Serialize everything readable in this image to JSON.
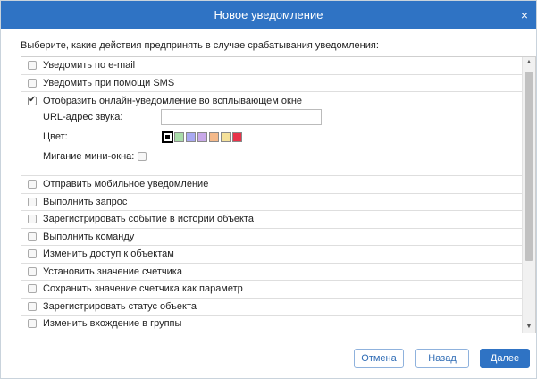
{
  "dialog": {
    "title": "Новое уведомление",
    "close_label": "×",
    "prompt": "Выберите, какие действия предпринять в случае срабатывания уведомления:"
  },
  "actions": [
    {
      "label": "Уведомить по e-mail",
      "checked": false
    },
    {
      "label": "Уведомить при помощи SMS",
      "checked": false
    },
    {
      "label": "Отобразить онлайн-уведомление во всплывающем окне",
      "checked": true
    },
    {
      "label": "Отправить мобильное уведомление",
      "checked": false
    },
    {
      "label": "Выполнить запрос",
      "checked": false
    },
    {
      "label": "Зарегистрировать событие в истории объекта",
      "checked": false
    },
    {
      "label": "Выполнить команду",
      "checked": false
    },
    {
      "label": "Изменить доступ к объектам",
      "checked": false
    },
    {
      "label": "Установить значение счетчика",
      "checked": false
    },
    {
      "label": "Сохранить значение счетчика как параметр",
      "checked": false
    },
    {
      "label": "Зарегистрировать статус объекта",
      "checked": false
    },
    {
      "label": "Изменить вхождение в группы",
      "checked": false
    }
  ],
  "popup_options": {
    "sound_url_label": "URL-адрес звука:",
    "sound_url_value": "",
    "color_label": "Цвет:",
    "colors": [
      "#ffffff",
      "#a9dca9",
      "#a9a9f2",
      "#c9a9e9",
      "#f4b98a",
      "#f5e19a",
      "#e8334a"
    ],
    "selected_color_index": 0,
    "blink_label": "Мигание мини-окна:",
    "blink_checked": false
  },
  "buttons": {
    "cancel": "Отмена",
    "back": "Назад",
    "next": "Далее"
  },
  "scroll": {
    "up_icon": "▲",
    "down_icon": "▼"
  }
}
